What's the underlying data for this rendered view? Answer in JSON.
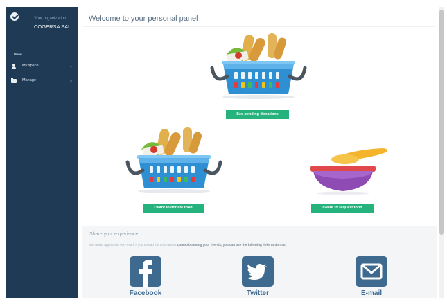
{
  "sidebar": {
    "org_caption": "Your organization",
    "org_name": "COGERSA SAU",
    "heading": "Menu",
    "items": [
      {
        "label": "My space",
        "icon": "user-icon"
      },
      {
        "label": "Manage",
        "icon": "folder-icon"
      }
    ]
  },
  "main": {
    "title": "Welcome to your personal panel",
    "actions": {
      "pending": "See pending donations",
      "donate": "I want to donate food",
      "request": "I want to request food"
    },
    "share": {
      "title": "Share your experience",
      "text_before": "We would appreciate very much if you spread the voice about ",
      "text_bold": "Lonmoio among your friends, you can use the following links to do that.",
      "links": [
        {
          "label": "Facebook",
          "icon": "facebook-icon"
        },
        {
          "label": "Twitter",
          "icon": "twitter-icon"
        },
        {
          "label": "E-mail",
          "icon": "email-icon"
        }
      ]
    }
  },
  "colors": {
    "sidebar_bg": "#1f3a55",
    "accent_green": "#26b27d",
    "social_blue": "#3e6a8f",
    "basket_blue": "#2f8fd3",
    "bowl_purple": "#8e4bb4"
  }
}
